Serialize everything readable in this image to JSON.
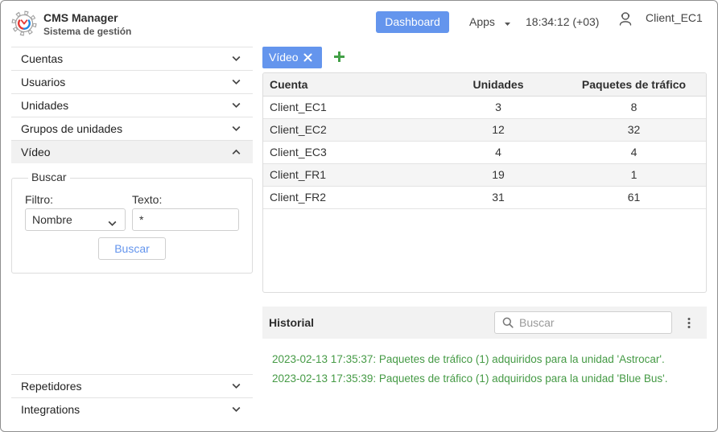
{
  "header": {
    "app_title": "CMS Manager",
    "app_subtitle": "Sistema de gestión",
    "dashboard_label": "Dashboard",
    "apps_label": "Apps",
    "clock": "18:34:12 (+03)",
    "user_name": "Client_EC1"
  },
  "sidebar": {
    "items": [
      {
        "label": "Cuentas",
        "expanded": false
      },
      {
        "label": "Usuarios",
        "expanded": false
      },
      {
        "label": "Unidades",
        "expanded": false
      },
      {
        "label": "Grupos de unidades",
        "expanded": false
      },
      {
        "label": "Vídeo",
        "expanded": true
      },
      {
        "label": "Repetidores",
        "expanded": false
      },
      {
        "label": "Integrations",
        "expanded": false
      }
    ],
    "search": {
      "legend": "Buscar",
      "filter_label": "Filtro:",
      "filter_value": "Nombre",
      "text_label": "Texto:",
      "text_value": "*",
      "button_label": "Buscar"
    }
  },
  "tabs": [
    {
      "label": "Vídeo",
      "active": true,
      "closable": true
    }
  ],
  "table": {
    "columns": [
      "Cuenta",
      "Unidades",
      "Paquetes de tráfico"
    ],
    "rows": [
      {
        "account": "Client_EC1",
        "units": 3,
        "traffic_packages": 8
      },
      {
        "account": "Client_EC2",
        "units": 12,
        "traffic_packages": 32
      },
      {
        "account": "Client_EC3",
        "units": 4,
        "traffic_packages": 4
      },
      {
        "account": "Client_FR1",
        "units": 19,
        "traffic_packages": 1
      },
      {
        "account": "Client_FR2",
        "units": 31,
        "traffic_packages": 61
      }
    ]
  },
  "history": {
    "title": "Historial",
    "search_placeholder": "Buscar",
    "entries": [
      "2023-02-13 17:35:37: Paquetes de tráfico (1) adquiridos para la unidad 'Astrocar'.",
      "2023-02-13 17:35:39: Paquetes de tráfico (1) adquiridos para la unidad 'Blue Bus'."
    ]
  },
  "colors": {
    "accent": "#6495ed",
    "add": "#43a047",
    "log_text": "#459a45",
    "logo_red": "#e53935",
    "logo_blue": "#1e88e5"
  },
  "icons": {
    "logo": "gear-logo-icon",
    "expand": "chevron-down-icon",
    "collapse": "chevron-up-icon",
    "apps_dropdown": "caret-down-icon",
    "user": "user-icon",
    "tab_close": "close-icon",
    "add_tab": "plus-icon",
    "search": "search-icon",
    "more": "kebab-menu-icon"
  }
}
